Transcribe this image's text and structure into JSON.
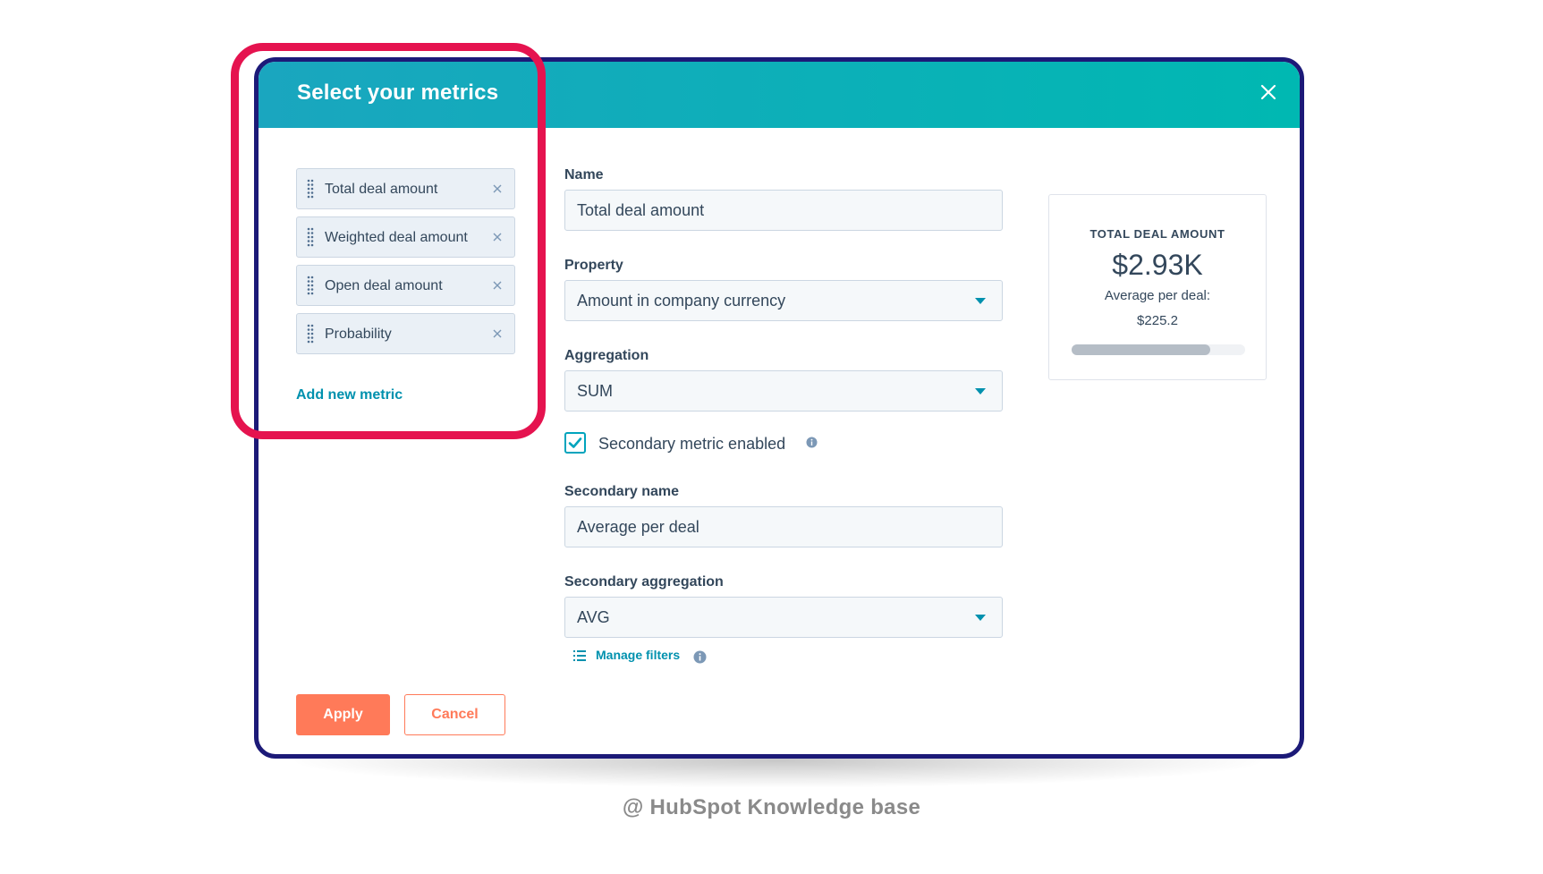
{
  "modal": {
    "title": "Select your metrics",
    "close_icon": "close-icon"
  },
  "metrics": {
    "items": [
      {
        "label": "Total deal amount"
      },
      {
        "label": "Weighted deal amount"
      },
      {
        "label": "Open deal amount"
      },
      {
        "label": "Probability"
      }
    ],
    "add_label": "Add new metric"
  },
  "form": {
    "name_label": "Name",
    "name_value": "Total deal amount",
    "property_label": "Property",
    "property_value": "Amount in company currency",
    "aggregation_label": "Aggregation",
    "aggregation_value": "SUM",
    "secondary_enabled_label": "Secondary metric enabled",
    "secondary_enabled": true,
    "secondary_name_label": "Secondary name",
    "secondary_name_value": "Average per deal",
    "secondary_aggregation_label": "Secondary aggregation",
    "secondary_aggregation_value": "AVG",
    "manage_filters_label": "Manage filters"
  },
  "preview": {
    "title": "TOTAL DEAL AMOUNT",
    "value": "$2.93K",
    "secondary_name": "Average per deal:",
    "secondary_value": "$225.2",
    "bar_fraction": 0.8
  },
  "buttons": {
    "apply_label": "Apply",
    "cancel_label": "Cancel"
  },
  "watermark": "@ HubSpot Knowledge base",
  "colors": {
    "header_gradient_start": "#1aa6bf",
    "header_gradient_end": "#00b8b2",
    "modal_border": "#1c1a78",
    "highlight": "#e5134f",
    "accent_link": "#0091ae",
    "primary_button": "#ff7a59"
  }
}
